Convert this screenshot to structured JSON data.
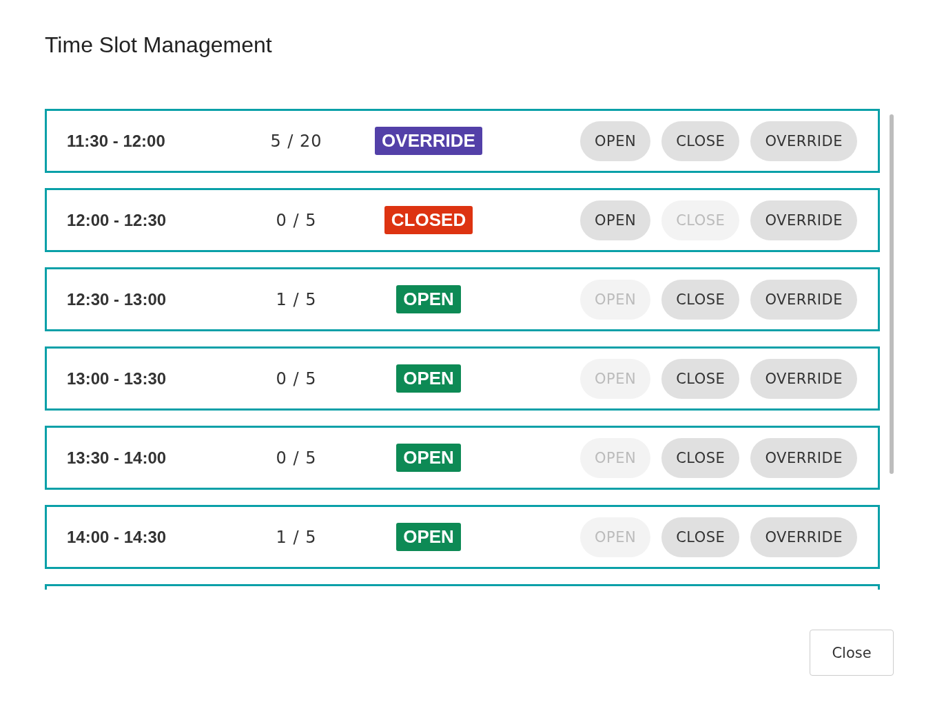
{
  "dialog": {
    "title": "Time Slot Management"
  },
  "slots": [
    {
      "time": "11:30 - 12:00",
      "count": "5 / 20",
      "status": {
        "label": "OVERRIDE",
        "kind": "override"
      },
      "actions": [
        {
          "label": "OPEN",
          "disabled": false
        },
        {
          "label": "CLOSE",
          "disabled": false
        },
        {
          "label": "OVERRIDE",
          "disabled": false
        }
      ]
    },
    {
      "time": "12:00 - 12:30",
      "count": "0 / 5",
      "status": {
        "label": "CLOSED",
        "kind": "closed"
      },
      "actions": [
        {
          "label": "OPEN",
          "disabled": false
        },
        {
          "label": "CLOSE",
          "disabled": true
        },
        {
          "label": "OVERRIDE",
          "disabled": false
        }
      ]
    },
    {
      "time": "12:30 - 13:00",
      "count": "1 / 5",
      "status": {
        "label": "OPEN",
        "kind": "open"
      },
      "actions": [
        {
          "label": "OPEN",
          "disabled": true
        },
        {
          "label": "CLOSE",
          "disabled": false
        },
        {
          "label": "OVERRIDE",
          "disabled": false
        }
      ]
    },
    {
      "time": "13:00 - 13:30",
      "count": "0 / 5",
      "status": {
        "label": "OPEN",
        "kind": "open"
      },
      "actions": [
        {
          "label": "OPEN",
          "disabled": true
        },
        {
          "label": "CLOSE",
          "disabled": false
        },
        {
          "label": "OVERRIDE",
          "disabled": false
        }
      ]
    },
    {
      "time": "13:30 - 14:00",
      "count": "0 / 5",
      "status": {
        "label": "OPEN",
        "kind": "open"
      },
      "actions": [
        {
          "label": "OPEN",
          "disabled": true
        },
        {
          "label": "CLOSE",
          "disabled": false
        },
        {
          "label": "OVERRIDE",
          "disabled": false
        }
      ]
    },
    {
      "time": "14:00 - 14:30",
      "count": "1 / 5",
      "status": {
        "label": "OPEN",
        "kind": "open"
      },
      "actions": [
        {
          "label": "OPEN",
          "disabled": true
        },
        {
          "label": "CLOSE",
          "disabled": false
        },
        {
          "label": "OVERRIDE",
          "disabled": false
        }
      ]
    }
  ],
  "footer": {
    "close_button": "Close"
  }
}
